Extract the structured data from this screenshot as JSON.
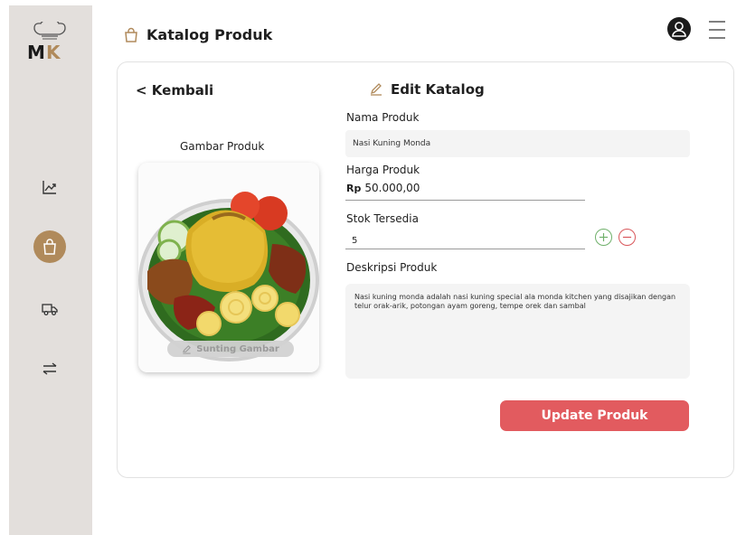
{
  "header": {
    "title": "Katalog Produk"
  },
  "sidebar": {
    "logo_text": "MK",
    "items": [
      {
        "icon": "chart-line-icon",
        "active": false
      },
      {
        "icon": "shopping-bag-icon",
        "active": true
      },
      {
        "icon": "truck-icon",
        "active": false
      },
      {
        "icon": "transfer-arrows-icon",
        "active": false
      }
    ]
  },
  "page": {
    "back_label": "< Kembali",
    "edit_title": "Edit Katalog"
  },
  "image_section": {
    "label": "Gambar Produk",
    "edit_button_label": "Sunting Gambar"
  },
  "form": {
    "name_label": "Nama Produk",
    "name_value": "Nasi Kuning Monda",
    "price_label": "Harga Produk",
    "price_currency": "Rp",
    "price_value": "50.000,00",
    "stock_label": "Stok Tersedia",
    "stock_value": "5",
    "description_label": "Deskripsi Produk",
    "description_value": "Nasi kuning monda adalah nasi kuning special ala monda kitchen yang disajikan dengan telur orak-arik, potongan ayam goreng, tempe orek dan sambal",
    "update_button": "Update Produk"
  },
  "colors": {
    "sidebar_bg": "#e3dfdc",
    "accent_brown": "#b08a5b",
    "update_red": "#e25b5f",
    "plus_green": "#6fb06a",
    "minus_red": "#d9575b"
  }
}
